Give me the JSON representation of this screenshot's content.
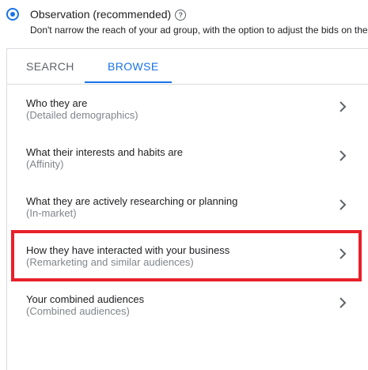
{
  "option": {
    "title": "Observation (recommended)",
    "help_icon_glyph": "?",
    "description": "Don't narrow the reach of your ad group, with the option to adjust the bids on the",
    "selected": true
  },
  "tabs": [
    {
      "label": "SEARCH",
      "active": false
    },
    {
      "label": "BROWSE",
      "active": true
    }
  ],
  "items": [
    {
      "title": "Who they are",
      "subtitle": "(Detailed demographics)",
      "icon": "chevron-right-icon"
    },
    {
      "title": "What their interests and habits are",
      "subtitle": "(Affinity)",
      "icon": "chevron-right-icon"
    },
    {
      "title": "What they are actively researching or planning",
      "subtitle": "(In-market)",
      "icon": "chevron-right-icon"
    },
    {
      "title": "How they have interacted with your business",
      "subtitle": "(Remarketing and similar audiences)",
      "icon": "chevron-right-icon"
    },
    {
      "title": "Your combined audiences",
      "subtitle": "(Combined audiences)",
      "icon": "chevron-right-icon"
    }
  ],
  "colors": {
    "accent": "#1a73e8",
    "highlight": "#e8202a",
    "border": "#dadce0",
    "secondary_text": "#80868b"
  }
}
